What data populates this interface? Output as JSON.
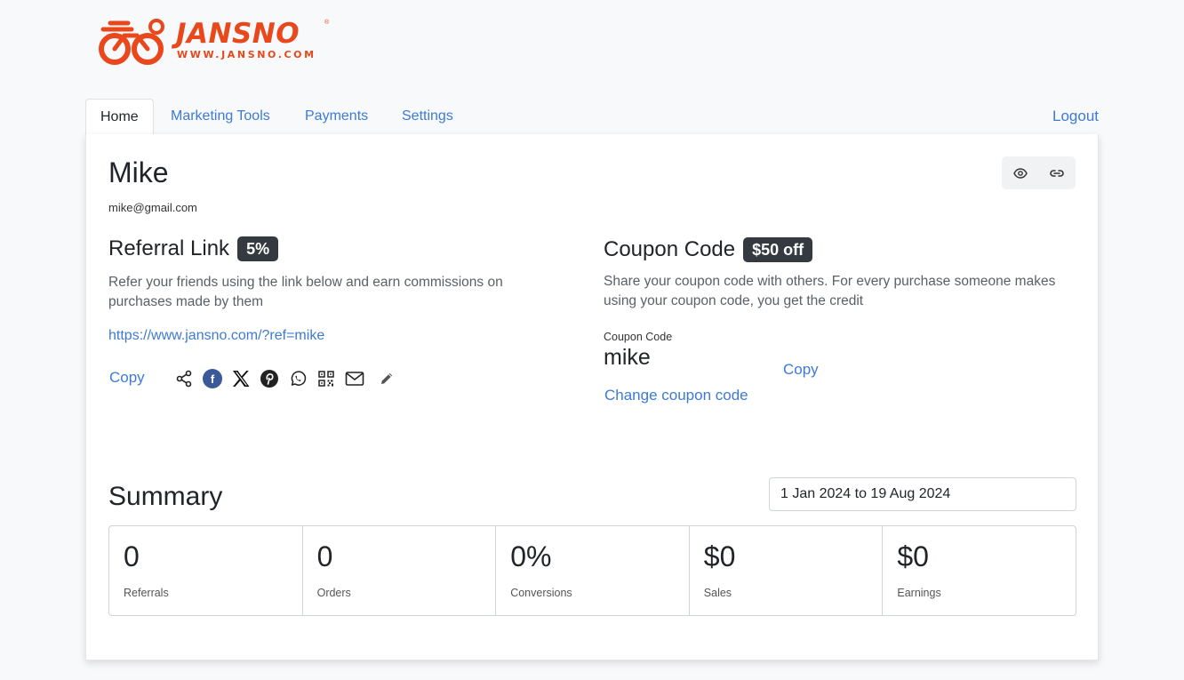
{
  "brand": {
    "name": "JANSNO",
    "url": "WWW.JANSNO.COM",
    "registered": "®",
    "color": "#e8481b"
  },
  "tabs": [
    {
      "label": "Home",
      "active": true
    },
    {
      "label": "Marketing Tools",
      "active": false
    },
    {
      "label": "Payments",
      "active": false
    },
    {
      "label": "Settings",
      "active": false
    }
  ],
  "header": {
    "logout_label": "Logout"
  },
  "profile": {
    "name": "Mike",
    "email": "mike@gmail.com"
  },
  "referral": {
    "title": "Referral Link",
    "badge": "5%",
    "description": "Refer your friends using the link below and earn commissions on purchases made by them",
    "link": "https://www.jansno.com/?ref=mike",
    "copy_label": "Copy",
    "share_icons": [
      "share-icon",
      "facebook-icon",
      "x-icon",
      "pinterest-icon",
      "whatsapp-icon",
      "qr-code-icon",
      "email-icon",
      "edit-pencil-icon"
    ]
  },
  "coupon": {
    "title": "Coupon Code",
    "badge": "$50 off",
    "description": "Share your coupon code with others. For every purchase someone makes using your coupon code, you get the credit",
    "label": "Coupon Code",
    "value": "mike",
    "copy_label": "Copy",
    "change_label": "Change coupon code"
  },
  "summary": {
    "title": "Summary",
    "date_range": "1 Jan 2024 to 19 Aug 2024",
    "stats": [
      {
        "value": "0",
        "label": "Referrals"
      },
      {
        "value": "0",
        "label": "Orders"
      },
      {
        "value": "0%",
        "label": "Conversions"
      },
      {
        "value": "$0",
        "label": "Sales"
      },
      {
        "value": "$0",
        "label": "Earnings"
      }
    ]
  },
  "colors": {
    "accent": "#3d7ad6",
    "badge_bg": "#343a40",
    "brand": "#e8481b"
  }
}
